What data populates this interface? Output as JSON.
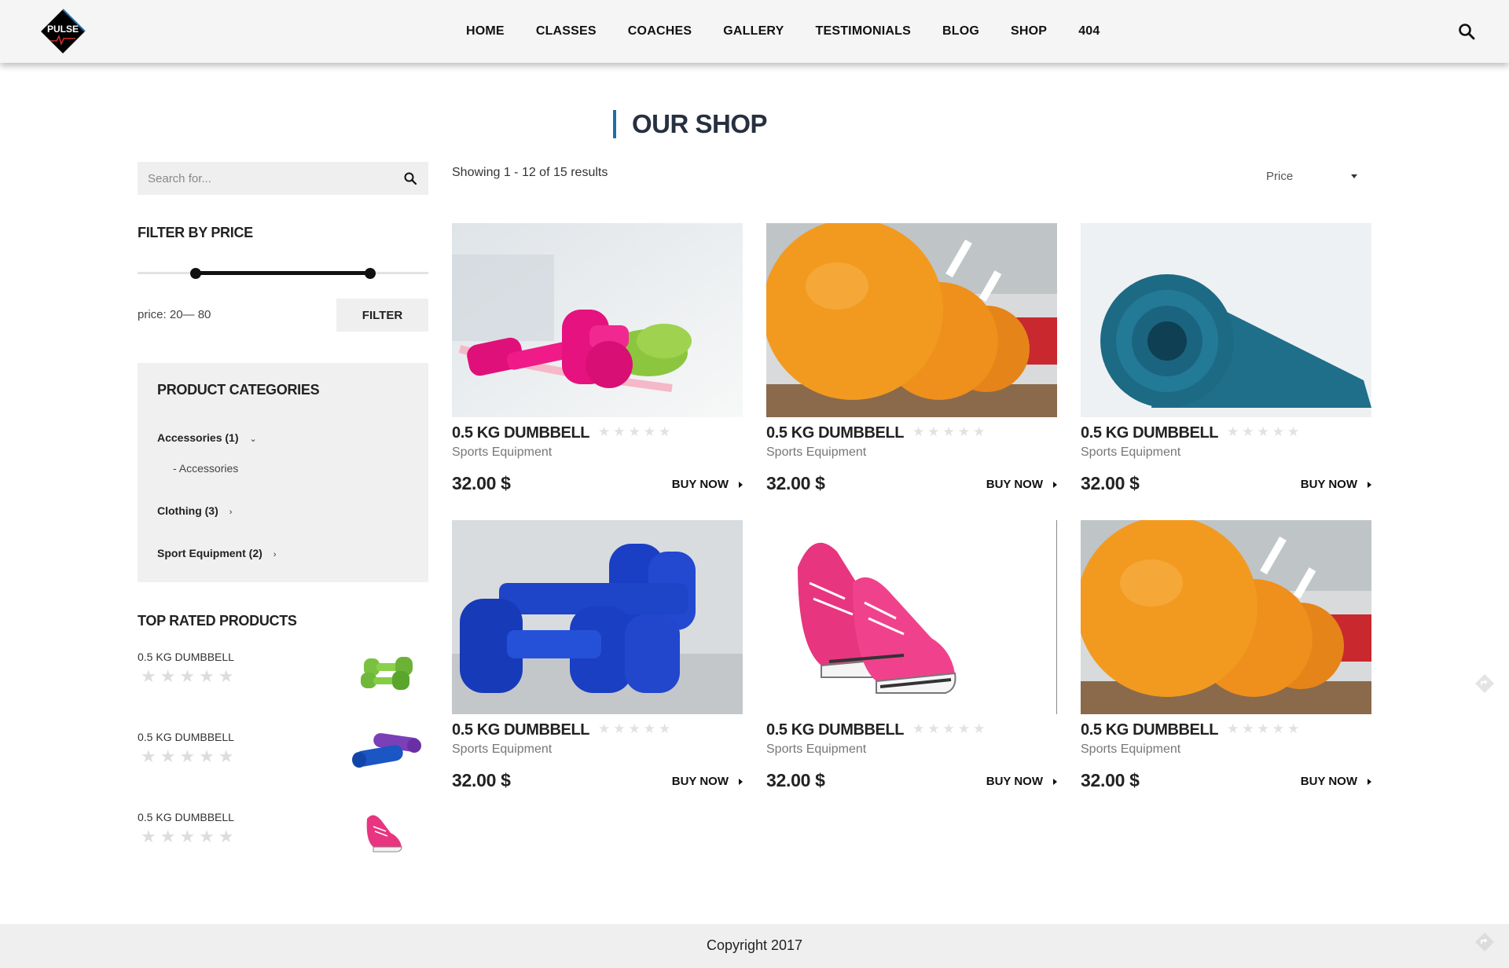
{
  "header": {
    "logo_text": "PULSE",
    "nav": [
      "HOME",
      "CLASSES",
      "COACHES",
      "GALLERY",
      "TESTIMONIALS",
      "BLOG",
      "SHOP",
      "404"
    ],
    "accent_color": "#1e6ea8"
  },
  "page": {
    "title": "OUR SHOP"
  },
  "sidebar": {
    "search_placeholder": "Search for...",
    "filter_heading": "FILTER BY PRICE",
    "price_range": [
      20,
      80
    ],
    "price_label": "price: 20— 80",
    "filter_button": "FILTER",
    "categories_heading": "PRODUCT CATEGORIES",
    "categories": [
      {
        "label": "Accessories (1)",
        "expanded": true,
        "sub": "- Accessories"
      },
      {
        "label": "Clothing (3)",
        "expanded": false
      },
      {
        "label": "Sport Equipment (2)",
        "expanded": false
      }
    ],
    "top_rated_heading": "TOP RATED PRODUCTS",
    "top_rated": [
      {
        "name": "0.5 KG DUMBBELL",
        "rating": 0,
        "image": "green-dumbbells"
      },
      {
        "name": "0.5 KG DUMBBELL",
        "rating": 0,
        "image": "yoga-mats"
      },
      {
        "name": "0.5 KG DUMBBELL",
        "rating": 0,
        "image": "pink-sneaker"
      }
    ]
  },
  "main": {
    "results_text": "Showing 1 - 12 of 15 results",
    "sort_label": "Price",
    "products": [
      {
        "name": "0.5 KG DUMBBELL",
        "category": "Sports Equipment",
        "price": "32.00 $",
        "buy": "BUY NOW",
        "rating": 0,
        "image": "pink-dumbbells"
      },
      {
        "name": "0.5 KG DUMBBELL",
        "category": "Sports Equipment",
        "price": "32.00 $",
        "buy": "BUY NOW",
        "rating": 0,
        "image": "orange-balls"
      },
      {
        "name": "0.5 KG DUMBBELL",
        "category": "Sports Equipment",
        "price": "32.00 $",
        "buy": "BUY NOW",
        "rating": 0,
        "image": "blue-mat"
      },
      {
        "name": "0.5 KG DUMBBELL",
        "category": "Sports Equipment",
        "price": "32.00 $",
        "buy": "BUY NOW",
        "rating": 0,
        "image": "blue-dumbbells"
      },
      {
        "name": "0.5 KG DUMBBELL",
        "category": "Sports Equipment",
        "price": "32.00 $",
        "buy": "BUY NOW",
        "rating": 0,
        "image": "pink-sneakers"
      },
      {
        "name": "0.5 KG DUMBBELL",
        "category": "Sports Equipment",
        "price": "32.00 $",
        "buy": "BUY NOW",
        "rating": 0,
        "image": "orange-balls"
      }
    ]
  },
  "footer": {
    "copyright": "Copyright 2017"
  }
}
